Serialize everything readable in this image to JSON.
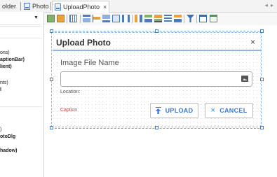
{
  "tabs": [
    {
      "label": "older"
    },
    {
      "label": "Photo"
    },
    {
      "label": "UploadPhoto",
      "close": "×"
    }
  ],
  "tab_nav": "◂ ▸",
  "left_panel": {
    "lines": [
      "ons)",
      "aptionBar)",
      "lient)",
      "nts)",
      "l",
      ")",
      "otoDlg",
      "hadow)"
    ]
  },
  "dialog": {
    "title": "Upload Photo",
    "close_glyph": "×",
    "field_label": "Image File Name",
    "input_value": "",
    "location_label": "Location:",
    "caption_label": "Caption",
    "upload_label": "UPLOAD",
    "cancel_label": "CANCEL",
    "cancel_glyph": "×"
  },
  "icons": {
    "upload": "upload-arrow-icon",
    "image": "image-icon",
    "toolbar": [
      "align-left-icon",
      "align-center-icon",
      "grid-icon",
      "align-top-icon",
      "align-middle-icon",
      "align-bottom-icon",
      "size-icon",
      "spacing-icon",
      "distribute-icon",
      "align-icon",
      "stack-icon",
      "order-icon",
      "filter-icon",
      "tab-order-icon",
      "preview-icon"
    ]
  },
  "colors": {
    "accent": "#3d7bd6",
    "caption": "#d23b3b",
    "selection": "#8cb4e6"
  }
}
